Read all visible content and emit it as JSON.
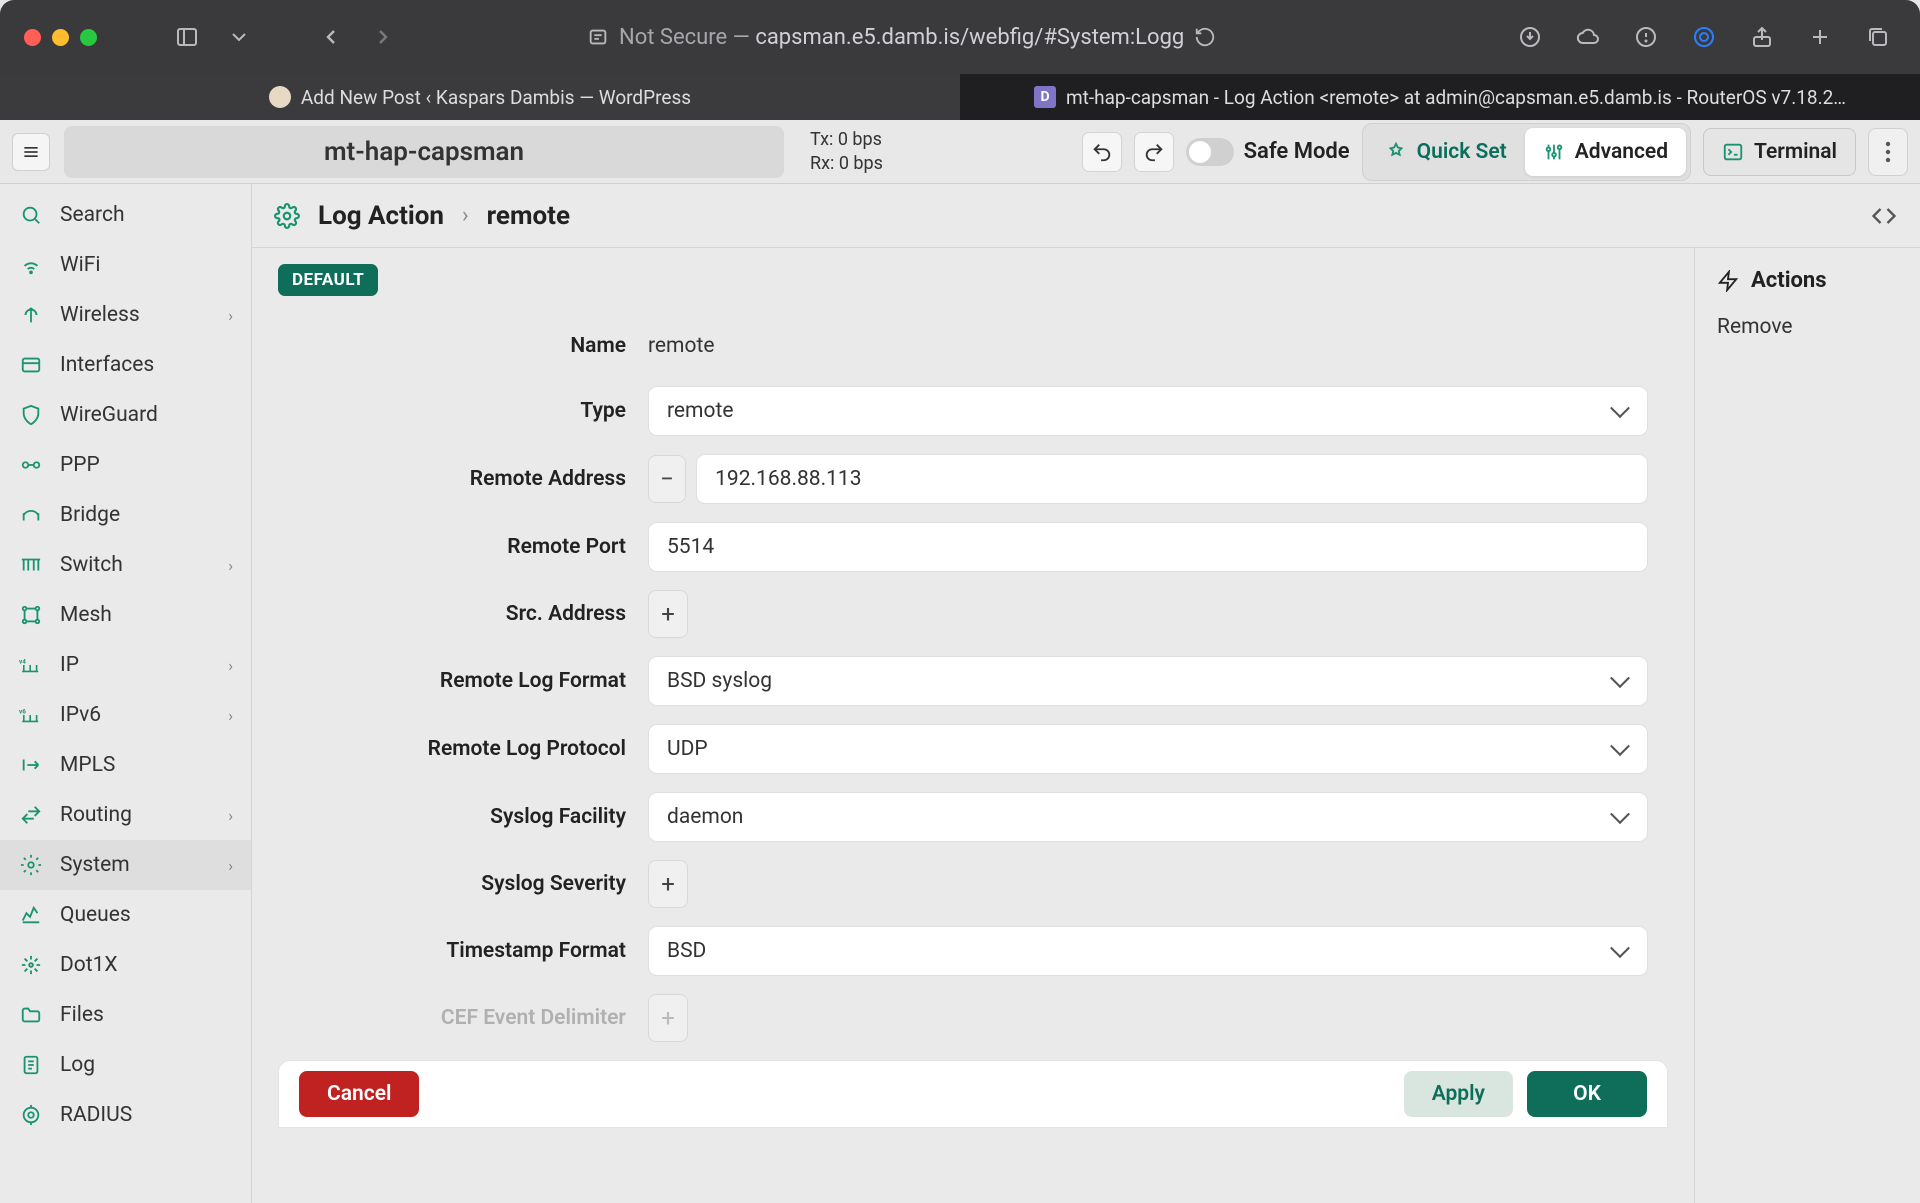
{
  "browser": {
    "security_prefix": "Not Secure — ",
    "url": "capsman.e5.damb.is/webfig/#System:Logg",
    "tabs": [
      {
        "label": "Add New Post ‹ Kaspars Dambis — WordPress"
      },
      {
        "label": "mt-hap-capsman - Log Action <remote> at admin@capsman.e5.damb.is - RouterOS v7.18.2…"
      }
    ]
  },
  "header": {
    "identity": "mt-hap-capsman",
    "tx": "Tx: 0 bps",
    "rx": "Rx: 0 bps",
    "safe_mode": "Safe Mode",
    "quick_set": "Quick Set",
    "advanced": "Advanced",
    "terminal": "Terminal"
  },
  "sidebar": {
    "items": [
      {
        "label": "Search",
        "icon": "search",
        "chev": false
      },
      {
        "label": "WiFi",
        "icon": "wifi",
        "chev": false
      },
      {
        "label": "Wireless",
        "icon": "antenna",
        "chev": true
      },
      {
        "label": "Interfaces",
        "icon": "interfaces",
        "chev": false
      },
      {
        "label": "WireGuard",
        "icon": "shield",
        "chev": false
      },
      {
        "label": "PPP",
        "icon": "ppp",
        "chev": false
      },
      {
        "label": "Bridge",
        "icon": "bridge",
        "chev": false
      },
      {
        "label": "Switch",
        "icon": "switch",
        "chev": true
      },
      {
        "label": "Mesh",
        "icon": "mesh",
        "chev": false
      },
      {
        "label": "IP",
        "icon": "ip",
        "chev": true
      },
      {
        "label": "IPv6",
        "icon": "ipv6",
        "chev": true
      },
      {
        "label": "MPLS",
        "icon": "mpls",
        "chev": false
      },
      {
        "label": "Routing",
        "icon": "routing",
        "chev": true
      },
      {
        "label": "System",
        "icon": "gear",
        "chev": true,
        "active": true
      },
      {
        "label": "Queues",
        "icon": "queues",
        "chev": false
      },
      {
        "label": "Dot1X",
        "icon": "dot1x",
        "chev": false
      },
      {
        "label": "Files",
        "icon": "files",
        "chev": false
      },
      {
        "label": "Log",
        "icon": "log",
        "chev": false
      },
      {
        "label": "RADIUS",
        "icon": "radius",
        "chev": false
      }
    ]
  },
  "breadcrumb": {
    "main": "Log Action",
    "sub": "remote"
  },
  "badge": "DEFAULT",
  "form": {
    "name_label": "Name",
    "name_value": "remote",
    "type_label": "Type",
    "type_value": "remote",
    "remote_addr_label": "Remote Address",
    "remote_addr_value": "192.168.88.113",
    "remote_port_label": "Remote Port",
    "remote_port_value": "5514",
    "src_addr_label": "Src. Address",
    "log_format_label": "Remote Log Format",
    "log_format_value": "BSD syslog",
    "log_proto_label": "Remote Log Protocol",
    "log_proto_value": "UDP",
    "syslog_facility_label": "Syslog Facility",
    "syslog_facility_value": "daemon",
    "syslog_severity_label": "Syslog Severity",
    "ts_format_label": "Timestamp Format",
    "ts_format_value": "BSD",
    "cef_delim_label": "CEF Event Delimiter"
  },
  "footer": {
    "cancel": "Cancel",
    "apply": "Apply",
    "ok": "OK"
  },
  "actions": {
    "title": "Actions",
    "remove": "Remove"
  }
}
